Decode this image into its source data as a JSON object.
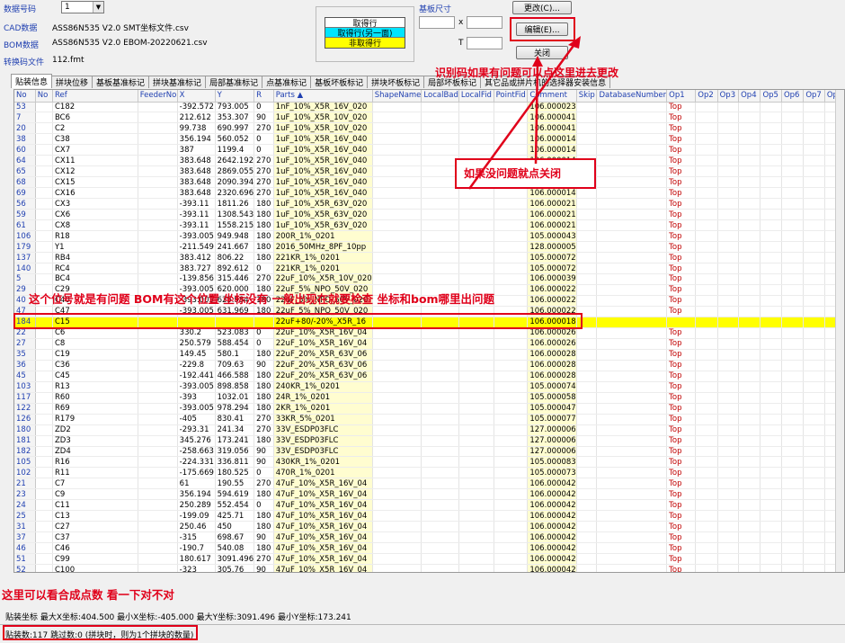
{
  "header": {
    "order_label": "数据号码",
    "order_value": "1",
    "cad_label": "CAD数据",
    "cad_file": "ASS86N535 V2.0 SMT坐标文件.csv",
    "bom_label": "BOM数据",
    "bom_file": "ASS86N535 V2.0 EBOM-20220621.csv",
    "conv_label": "转换码文件",
    "conv_file": "112.fmt",
    "legend": [
      {
        "label": "取得行",
        "color": "#ffffff"
      },
      {
        "label": "取得行(另一面)",
        "color": "#00e5ff"
      },
      {
        "label": "非取得行",
        "color": "#ffff00"
      }
    ],
    "board_size_label": "基板尺寸",
    "x_label": "x",
    "t_label": "T",
    "btn_change": "更改(C)...",
    "btn_edit": "编辑(E)...",
    "btn_close": "关闭"
  },
  "tabs": [
    "贴装信息",
    "拼块位移",
    "基板基准标记",
    "拼块基准标记",
    "局部基准标记",
    "点基准标记",
    "基板坏板标记",
    "拼块坏板标记",
    "局部坏板标记",
    "其它品或拼片机的选择器安装信息"
  ],
  "columns": [
    "No",
    "No",
    "Ref",
    "FeederNo",
    "X",
    "Y",
    "R",
    "Parts ▲",
    "ShapeName",
    "LocalBad",
    "LocalFid",
    "PointFid",
    "Comment",
    "Skip",
    "DatabaseNumber",
    "Op1",
    "Op2",
    "Op3",
    "Op4",
    "Op5",
    "Op6",
    "Op7",
    "Op"
  ],
  "rows": [
    {
      "no": "53",
      "ref": "C182",
      "x": "-392.572",
      "y": "793.005",
      "r": "0",
      "parts": "1nF_10%_X5R_16V_020",
      "comment": "106.000023",
      "op1": "Top"
    },
    {
      "no": "7",
      "ref": "BC6",
      "x": "212.612",
      "y": "353.307",
      "r": "90",
      "parts": "1uF_10%_X5R_10V_020",
      "comment": "106.000041",
      "op1": "Top"
    },
    {
      "no": "20",
      "ref": "C2",
      "x": "99.738",
      "y": "690.997",
      "r": "270",
      "parts": "1uF_10%_X5R_10V_020",
      "comment": "106.000041",
      "op1": "Top"
    },
    {
      "no": "38",
      "ref": "C38",
      "x": "356.194",
      "y": "560.052",
      "r": "0",
      "parts": "1uF_10%_X5R_16V_040",
      "comment": "106.000014",
      "op1": "Top"
    },
    {
      "no": "60",
      "ref": "CX7",
      "x": "387",
      "y": "1199.4",
      "r": "0",
      "parts": "1uF_10%_X5R_16V_040",
      "comment": "106.000014",
      "op1": "Top"
    },
    {
      "no": "64",
      "ref": "CX11",
      "x": "383.648",
      "y": "2642.192",
      "r": "270",
      "parts": "1uF_10%_X5R_16V_040",
      "comment": "106.000014",
      "op1": "Top"
    },
    {
      "no": "65",
      "ref": "CX12",
      "x": "383.648",
      "y": "2869.055",
      "r": "270",
      "parts": "1uF_10%_X5R_16V_040",
      "comment": "106.000014",
      "op1": "Top"
    },
    {
      "no": "68",
      "ref": "CX15",
      "x": "383.648",
      "y": "2090.394",
      "r": "270",
      "parts": "1uF_10%_X5R_16V_040",
      "comment": "106.000014",
      "op1": "Top"
    },
    {
      "no": "69",
      "ref": "CX16",
      "x": "383.648",
      "y": "2320.696",
      "r": "270",
      "parts": "1uF_10%_X5R_16V_040",
      "comment": "106.000014",
      "op1": "Top"
    },
    {
      "no": "56",
      "ref": "CX3",
      "x": "-393.11",
      "y": "1811.26",
      "r": "180",
      "parts": "1uF_10%_X5R_63V_020",
      "comment": "106.000021",
      "op1": "Top"
    },
    {
      "no": "59",
      "ref": "CX6",
      "x": "-393.11",
      "y": "1308.543",
      "r": "180",
      "parts": "1uF_10%_X5R_63V_020",
      "comment": "106.000021",
      "op1": "Top"
    },
    {
      "no": "61",
      "ref": "CX8",
      "x": "-393.11",
      "y": "1558.215",
      "r": "180",
      "parts": "1uF_10%_X5R_63V_020",
      "comment": "106.000021",
      "op1": "Top"
    },
    {
      "no": "106",
      "ref": "R18",
      "x": "-393.005",
      "y": "949.948",
      "r": "180",
      "parts": "200R_1%_0201",
      "comment": "105.000043",
      "op1": "Top"
    },
    {
      "no": "179",
      "ref": "Y1",
      "x": "-211.549",
      "y": "241.667",
      "r": "180",
      "parts": "2016_50MHz_8PF_10pp",
      "comment": "128.000005",
      "op1": "Top"
    },
    {
      "no": "137",
      "ref": "RB4",
      "x": "383.412",
      "y": "806.22",
      "r": "180",
      "parts": "221KR_1%_0201",
      "comment": "105.000072",
      "op1": "Top"
    },
    {
      "no": "140",
      "ref": "RC4",
      "x": "383.727",
      "y": "892.612",
      "r": "0",
      "parts": "221KR_1%_0201",
      "comment": "105.000072",
      "op1": "Top"
    },
    {
      "no": "5",
      "ref": "BC4",
      "x": "-139.856",
      "y": "315.446",
      "r": "270",
      "parts": "22uF_10%_X5R_10V_020",
      "comment": "106.000039",
      "op1": "Top"
    },
    {
      "no": "29",
      "ref": "C29",
      "x": "-393.005",
      "y": "620.000",
      "r": "180",
      "parts": "22uF_5%_NPO_50V_020",
      "comment": "106.000022",
      "op1": "Top"
    },
    {
      "no": "40",
      "ref": "C40",
      "x": "-393.005",
      "y": "625.984",
      "r": "180",
      "parts": "22uF_5%_NPO_50V_020",
      "comment": "106.000022",
      "op1": "Top"
    },
    {
      "no": "47",
      "ref": "C47",
      "x": "-393.005",
      "y": "631.969",
      "r": "180",
      "parts": "22uF_5%_NPO_50V_020",
      "comment": "106.000022",
      "op1": "Top"
    },
    {
      "no": "184",
      "ref": "C15",
      "x": "",
      "y": "",
      "r": "",
      "parts": "22uF+80/-20%_X5R_16",
      "comment": "106.000018",
      "op1": "",
      "hl": true
    },
    {
      "no": "22",
      "ref": "C6",
      "x": "330.2",
      "y": "523.083",
      "r": "0",
      "parts": "22uF_10%_X5R_16V_04",
      "comment": "106.000026",
      "op1": "Top"
    },
    {
      "no": "27",
      "ref": "C8",
      "x": "250.579",
      "y": "588.454",
      "r": "0",
      "parts": "22uF_10%_X5R_16V_04",
      "comment": "106.000026",
      "op1": "Top"
    },
    {
      "no": "35",
      "ref": "C19",
      "x": "149.45",
      "y": "580.1",
      "r": "180",
      "parts": "22uF_20%_X5R_63V_06",
      "comment": "106.000028",
      "op1": "Top"
    },
    {
      "no": "36",
      "ref": "C36",
      "x": "-229.8",
      "y": "709.63",
      "r": "90",
      "parts": "22uF_20%_X5R_63V_06",
      "comment": "106.000028",
      "op1": "Top"
    },
    {
      "no": "45",
      "ref": "C45",
      "x": "-192.441",
      "y": "466.588",
      "r": "180",
      "parts": "22uF_20%_X5R_63V_06",
      "comment": "106.000028",
      "op1": "Top"
    },
    {
      "no": "103",
      "ref": "R13",
      "x": "-393.005",
      "y": "898.858",
      "r": "180",
      "parts": "240KR_1%_0201",
      "comment": "105.000074",
      "op1": "Top"
    },
    {
      "no": "117",
      "ref": "R60",
      "x": "-393",
      "y": "1032.01",
      "r": "180",
      "parts": "24R_1%_0201",
      "comment": "105.000058",
      "op1": "Top"
    },
    {
      "no": "122",
      "ref": "R69",
      "x": "-393.005",
      "y": "978.294",
      "r": "180",
      "parts": "2KR_1%_0201",
      "comment": "105.000047",
      "op1": "Top"
    },
    {
      "no": "126",
      "ref": "R179",
      "x": "-405",
      "y": "830.41",
      "r": "270",
      "parts": "33KR_5%_0201",
      "comment": "105.000077",
      "op1": "Top"
    },
    {
      "no": "180",
      "ref": "ZD2",
      "x": "-293.31",
      "y": "241.34",
      "r": "270",
      "parts": "33V_ESDP03FLC",
      "comment": "127.000006",
      "op1": "Top"
    },
    {
      "no": "181",
      "ref": "ZD3",
      "x": "345.276",
      "y": "173.241",
      "r": "180",
      "parts": "33V_ESDP03FLC",
      "comment": "127.000006",
      "op1": "Top"
    },
    {
      "no": "182",
      "ref": "ZD4",
      "x": "-258.663",
      "y": "319.056",
      "r": "90",
      "parts": "33V_ESDP03FLC",
      "comment": "127.000006",
      "op1": "Top"
    },
    {
      "no": "105",
      "ref": "R16",
      "x": "-224.331",
      "y": "336.811",
      "r": "90",
      "parts": "430KR_1%_0201",
      "comment": "105.000083",
      "op1": "Top"
    },
    {
      "no": "102",
      "ref": "R11",
      "x": "-175.669",
      "y": "180.525",
      "r": "0",
      "parts": "470R_1%_0201",
      "comment": "105.000073",
      "op1": "Top"
    },
    {
      "no": "21",
      "ref": "C7",
      "x": "61",
      "y": "190.55",
      "r": "270",
      "parts": "47uF_10%_X5R_16V_04",
      "comment": "106.000042",
      "op1": "Top"
    },
    {
      "no": "23",
      "ref": "C9",
      "x": "356.194",
      "y": "594.619",
      "r": "180",
      "parts": "47uF_10%_X5R_16V_04",
      "comment": "106.000042",
      "op1": "Top"
    },
    {
      "no": "24",
      "ref": "C11",
      "x": "250.289",
      "y": "552.454",
      "r": "0",
      "parts": "47uF_10%_X5R_16V_04",
      "comment": "106.000042",
      "op1": "Top"
    },
    {
      "no": "25",
      "ref": "C13",
      "x": "-199.09",
      "y": "425.71",
      "r": "180",
      "parts": "47uF_10%_X5R_16V_04",
      "comment": "106.000042",
      "op1": "Top"
    },
    {
      "no": "31",
      "ref": "C27",
      "x": "250.46",
      "y": "450",
      "r": "180",
      "parts": "47uF_10%_X5R_16V_04",
      "comment": "106.000042",
      "op1": "Top"
    },
    {
      "no": "37",
      "ref": "C37",
      "x": "-315",
      "y": "698.67",
      "r": "90",
      "parts": "47uF_10%_X5R_16V_04",
      "comment": "106.000042",
      "op1": "Top"
    },
    {
      "no": "46",
      "ref": "C46",
      "x": "-190.7",
      "y": "540.08",
      "r": "180",
      "parts": "47uF_10%_X5R_16V_04",
      "comment": "106.000042",
      "op1": "Top"
    },
    {
      "no": "51",
      "ref": "C99",
      "x": "180.617",
      "y": "3091.496",
      "r": "270",
      "parts": "47uF_10%_X5R_16V_04",
      "comment": "106.000042",
      "op1": "Top"
    },
    {
      "no": "52",
      "ref": "C100",
      "x": "-323",
      "y": "305.76",
      "r": "90",
      "parts": "47uF_10%_X5R_16V_04",
      "comment": "106.000042",
      "op1": "Top"
    }
  ],
  "footer": {
    "coords": "贴装坐标 最大X坐标:404.500 最小X坐标:-405.000 最大Y坐标:3091.496 最小Y坐标:173.241",
    "status": "贴装数:117 跳过数:0 (拼块时，则为1个拼块的数量)"
  },
  "annotations": {
    "edit_note": "识别码如果有问题可以点这里进去更改",
    "close_note": "如果没问题就点关闭",
    "row_note": "这个位号就是有问题 BOM有这个位置 坐标没有 一般出现在就要检查 坐标和bom哪里出问题",
    "count_note": "这里可以看合成点数 看一下对不对"
  },
  "colors": {
    "annotation": "#e0001a",
    "highlight": "#ffff00",
    "parts_bg": "#fffdd0",
    "top_text": "#c00000"
  }
}
